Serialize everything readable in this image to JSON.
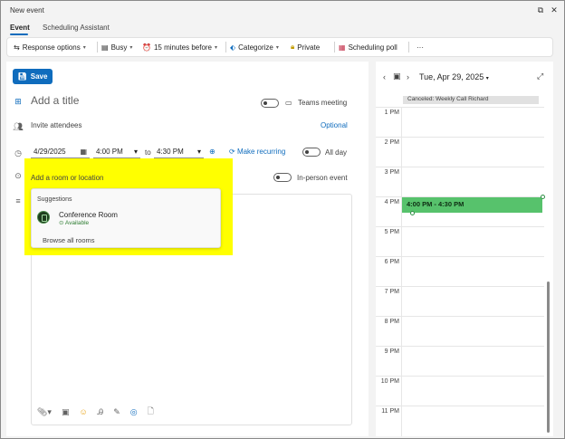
{
  "window": {
    "title": "New event"
  },
  "tabs": [
    {
      "label": "Event"
    },
    {
      "label": "Scheduling Assistant"
    }
  ],
  "toolbar": {
    "response_options": "Response options",
    "busy": "Busy",
    "reminder": "15 minutes before",
    "categorize": "Categorize",
    "private": "Private",
    "scheduling_poll": "Scheduling poll",
    "more": "···"
  },
  "form": {
    "save_label": "Save",
    "title_placeholder": "Add a title",
    "teams_meeting": "Teams meeting",
    "attendees_placeholder": "Invite attendees",
    "optional": "Optional",
    "start_date": "4/29/2025",
    "start_time": "4:00 PM",
    "to": "to",
    "end_time": "4:30 PM",
    "make_recurring": "Make recurring",
    "all_day": "All day",
    "location_placeholder": "Add a room or location",
    "in_person": "In-person event"
  },
  "suggestions": {
    "heading": "Suggestions",
    "room_name": "Conference Room",
    "room_status": "Available",
    "browse": "Browse all rooms"
  },
  "calendar": {
    "date": "Tue, Apr 29, 2025",
    "canceled_event": "Canceled: Weekly Call Richard",
    "hours": [
      "1 PM",
      "2 PM",
      "3 PM",
      "4 PM",
      "5 PM",
      "6 PM",
      "7 PM",
      "8 PM",
      "9 PM",
      "10 PM",
      "11 PM"
    ],
    "event_time": "4:00 PM - 4:30 PM"
  },
  "colors": {
    "accent": "#0f6cbd",
    "event": "#57c26c",
    "highlight": "#ffff00"
  }
}
